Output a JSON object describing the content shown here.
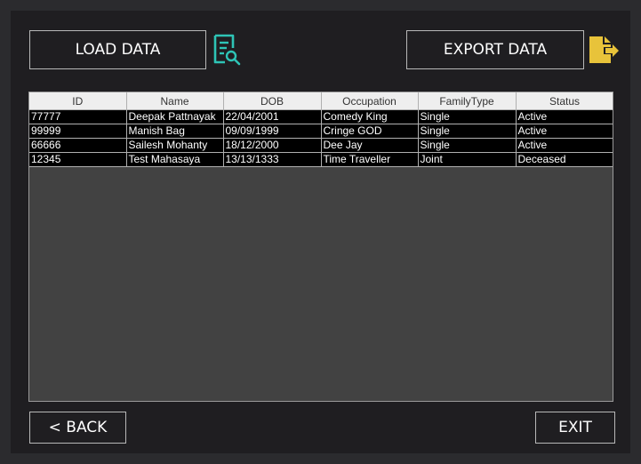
{
  "buttons": {
    "load": "LOAD DATA",
    "export": "EXPORT DATA",
    "back": "< BACK",
    "exit": "EXIT"
  },
  "icons": {
    "load_icon": "search-document-icon",
    "export_icon": "export-document-icon",
    "load_icon_color": "#2ec4b6",
    "export_icon_color": "#e8c33a"
  },
  "table": {
    "columns": [
      "ID",
      "Name",
      "DOB",
      "Occupation",
      "FamilyType",
      "Status"
    ],
    "rows": [
      [
        "77777",
        "Deepak Pattnayak",
        "22/04/2001",
        "Comedy King",
        "Single",
        "Active"
      ],
      [
        "99999",
        "Manish Bag",
        "09/09/1999",
        "Cringe GOD",
        "Single",
        "Active"
      ],
      [
        "66666",
        "Sailesh Mohanty",
        "18/12/2000",
        "Dee Jay",
        "Single",
        "Active"
      ],
      [
        "12345",
        "Test Mahasaya",
        "13/13/1333",
        "Time Traveller",
        "Joint",
        "Deceased"
      ]
    ]
  }
}
